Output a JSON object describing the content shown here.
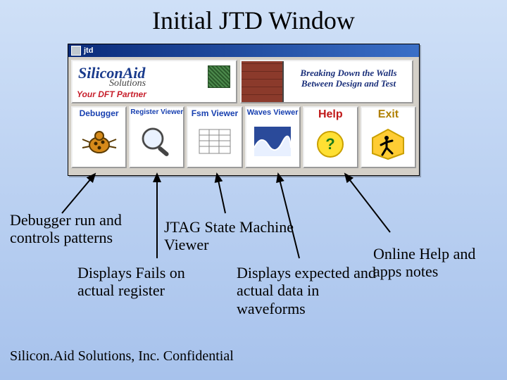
{
  "slide": {
    "title": "Initial JTD Window"
  },
  "window": {
    "title": "jtd",
    "logo": {
      "brand": "SiliconAid",
      "sub": "Solutions",
      "tagline": "Your DFT Partner"
    },
    "slogan": "Breaking Down the Walls Between Design and Test",
    "buttons": [
      {
        "key": "debugger",
        "label": "Debugger"
      },
      {
        "key": "regview",
        "label": "Register Viewer"
      },
      {
        "key": "fsm",
        "label": "Fsm Viewer"
      },
      {
        "key": "waves",
        "label": "Waves Viewer"
      },
      {
        "key": "help",
        "label": "Help"
      },
      {
        "key": "exit",
        "label": "Exit"
      }
    ]
  },
  "annotations": {
    "debugger": "Debugger run and controls patterns",
    "regview": "Displays Fails on actual register",
    "fsm": "JTAG State Machine Viewer",
    "waves": "Displays expected and actual data in waveforms",
    "help": "Online Help and apps notes"
  },
  "footer": "Silicon.Aid Solutions, Inc. Confidential"
}
